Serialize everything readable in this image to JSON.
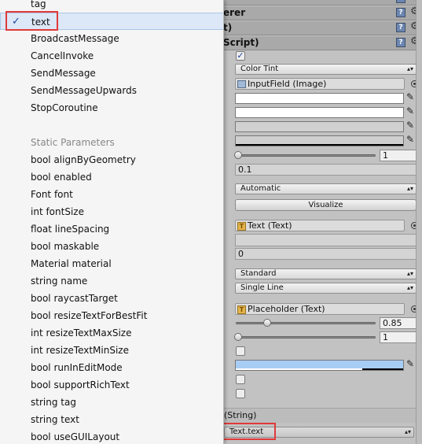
{
  "menu": {
    "items_top": [
      "tag",
      "text",
      "BroadcastMessage",
      "CancelInvoke",
      "SendMessage",
      "SendMessageUpwards",
      "StopCoroutine"
    ],
    "selected_item": "text",
    "static_header": "Static Parameters",
    "items_static": [
      "bool alignByGeometry",
      "bool enabled",
      "Font font",
      "int fontSize",
      "float lineSpacing",
      "bool maskable",
      "Material material",
      "string name",
      "bool raycastTarget",
      "bool resizeTextForBestFit",
      "int resizeTextMaxSize",
      "int resizeTextMinSize",
      "bool runInEditMode",
      "bool supportRichText",
      "string tag",
      "string text",
      "bool useGUILayout"
    ],
    "check_glyph": "✓"
  },
  "inspector": {
    "headers": [
      "erer",
      "t)",
      "Script)"
    ],
    "help_icon": "?",
    "gear_icon": "⚙",
    "transition_dropdown": "Color Tint",
    "target_graphic": "InputField (Image)",
    "slider1_value": "1",
    "fade_value": "0.1",
    "navigation_dropdown": "Automatic",
    "visualize_button": "Visualize",
    "text_component": "Text (Text)",
    "char_limit_value": "0",
    "content_type_dropdown": "Standard",
    "line_type_dropdown": "Single Line",
    "placeholder_component": "Placeholder (Text)",
    "caret_blink_value": "0.85",
    "caret_width_value": "1",
    "string_label": "(String)",
    "function_dropdown": "Text.text",
    "dropdown_arrow": "▴▾",
    "picker_glyph": "✎"
  },
  "colors": {
    "highlight_box": "#e03a3a",
    "selection_color": "#a8cdf5"
  }
}
